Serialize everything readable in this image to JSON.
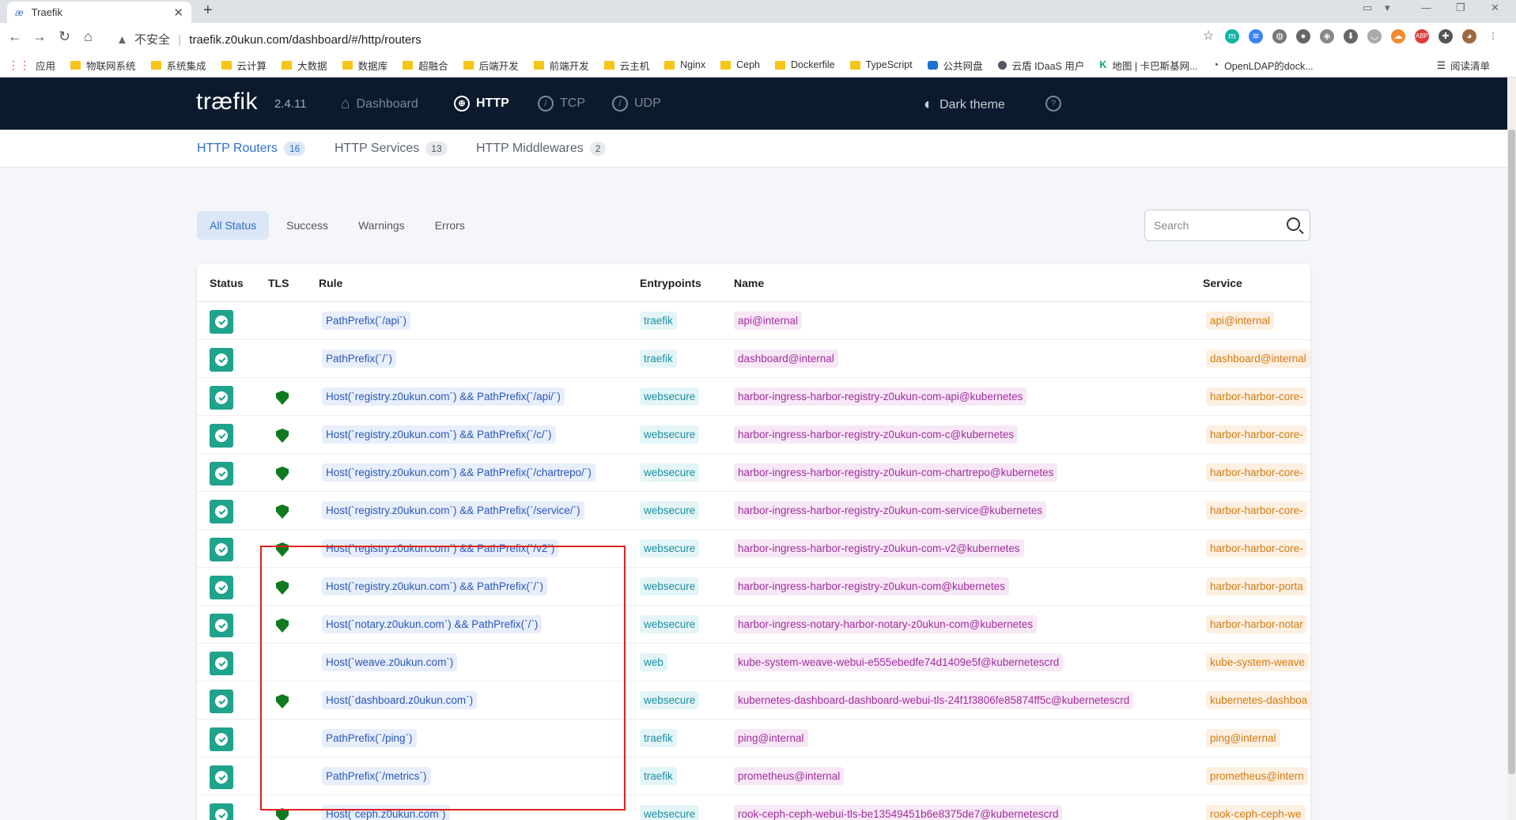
{
  "browser": {
    "tab_title": "Traefik",
    "url_warning": "不安全",
    "url": "traefik.z0ukun.com/dashboard/#/http/routers"
  },
  "bookmarks": [
    "应用",
    "物联网系统",
    "系统集成",
    "云计算",
    "大数据",
    "数据库",
    "超融合",
    "后端开发",
    "前端开发",
    "云主机",
    "Nginx",
    "Ceph",
    "Dockerfile",
    "TypeScript",
    "公共网盘",
    "云盾 IDaaS 用户",
    "地图 | 卡巴斯基网...",
    "OpenLDAP的dock..."
  ],
  "reading_list": "阅读清单",
  "app": {
    "logo": "træfik",
    "version": "2.4.11",
    "nav": [
      "Dashboard",
      "HTTP",
      "TCP",
      "UDP"
    ],
    "theme": "Dark theme"
  },
  "subnav": [
    {
      "label": "HTTP Routers",
      "count": "16"
    },
    {
      "label": "HTTP Services",
      "count": "13"
    },
    {
      "label": "HTTP Middlewares",
      "count": "2"
    }
  ],
  "filters": [
    "All Status",
    "Success",
    "Warnings",
    "Errors"
  ],
  "search_placeholder": "Search",
  "columns": [
    "Status",
    "TLS",
    "Rule",
    "Entrypoints",
    "Name",
    "Service"
  ],
  "rows": [
    {
      "tls": false,
      "rule": "PathPrefix(`/api`)",
      "ep": "traefik",
      "name": "api@internal",
      "service": "api@internal"
    },
    {
      "tls": false,
      "rule": "PathPrefix(`/`)",
      "ep": "traefik",
      "name": "dashboard@internal",
      "service": "dashboard@internal"
    },
    {
      "tls": true,
      "rule": "Host(`registry.z0ukun.com`) && PathPrefix(`/api/`)",
      "ep": "websecure",
      "name": "harbor-ingress-harbor-registry-z0ukun-com-api@kubernetes",
      "service": "harbor-harbor-core-"
    },
    {
      "tls": true,
      "rule": "Host(`registry.z0ukun.com`) && PathPrefix(`/c/`)",
      "ep": "websecure",
      "name": "harbor-ingress-harbor-registry-z0ukun-com-c@kubernetes",
      "service": "harbor-harbor-core-"
    },
    {
      "tls": true,
      "rule": "Host(`registry.z0ukun.com`) && PathPrefix(`/chartrepo/`)",
      "ep": "websecure",
      "name": "harbor-ingress-harbor-registry-z0ukun-com-chartrepo@kubernetes",
      "service": "harbor-harbor-core-"
    },
    {
      "tls": true,
      "rule": "Host(`registry.z0ukun.com`) && PathPrefix(`/service/`)",
      "ep": "websecure",
      "name": "harbor-ingress-harbor-registry-z0ukun-com-service@kubernetes",
      "service": "harbor-harbor-core-"
    },
    {
      "tls": true,
      "rule": "Host(`registry.z0ukun.com`) && PathPrefix(`/v2`)",
      "ep": "websecure",
      "name": "harbor-ingress-harbor-registry-z0ukun-com-v2@kubernetes",
      "service": "harbor-harbor-core-"
    },
    {
      "tls": true,
      "rule": "Host(`registry.z0ukun.com`) && PathPrefix(`/`)",
      "ep": "websecure",
      "name": "harbor-ingress-harbor-registry-z0ukun-com@kubernetes",
      "service": "harbor-harbor-porta"
    },
    {
      "tls": true,
      "rule": "Host(`notary.z0ukun.com`) && PathPrefix(`/`)",
      "ep": "websecure",
      "name": "harbor-ingress-notary-harbor-notary-z0ukun-com@kubernetes",
      "service": "harbor-harbor-notar"
    },
    {
      "tls": false,
      "rule": "Host(`weave.z0ukun.com`)",
      "ep": "web",
      "name": "kube-system-weave-webui-e555ebedfe74d1409e5f@kubernetescrd",
      "service": "kube-system-weave"
    },
    {
      "tls": true,
      "rule": "Host(`dashboard.z0ukun.com`)",
      "ep": "websecure",
      "name": "kubernetes-dashboard-dashboard-webui-tls-24f1f3806fe85874ff5c@kubernetescrd",
      "service": "kubernetes-dashboa"
    },
    {
      "tls": false,
      "rule": "PathPrefix(`/ping`)",
      "ep": "traefik",
      "name": "ping@internal",
      "service": "ping@internal"
    },
    {
      "tls": false,
      "rule": "PathPrefix(`/metrics`)",
      "ep": "traefik",
      "name": "prometheus@internal",
      "service": "prometheus@intern"
    },
    {
      "tls": true,
      "rule": "Host(`ceph.z0ukun.com`)",
      "ep": "websecure",
      "name": "rook-ceph-ceph-webui-tls-be13549451b6e8375de7@kubernetescrd",
      "service": "rook-ceph-ceph-we"
    }
  ]
}
